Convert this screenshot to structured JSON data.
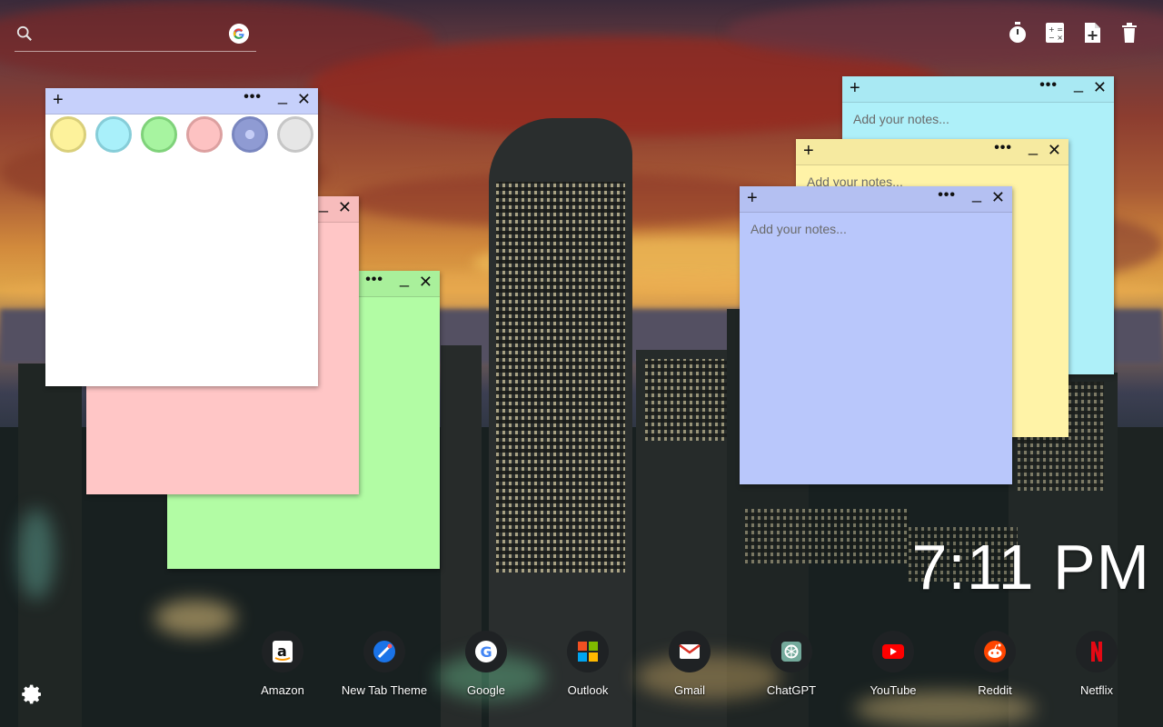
{
  "search": {
    "placeholder": ""
  },
  "top_icons": [
    "timer-icon",
    "calculator-icon",
    "add-note-icon",
    "trash-icon"
  ],
  "notes": [
    {
      "color": "#aef0f9",
      "bar_color": "#a9e9f3",
      "placeholder": "Add your notes..."
    },
    {
      "color": "#fff3a7",
      "bar_color": "#f6eaa0",
      "placeholder": "Add your notes..."
    },
    {
      "color": "#b9c7fb",
      "bar_color": "#b4c0f2",
      "placeholder": "Add your notes..."
    },
    {
      "color": "#ffc6c6",
      "bar_color": "#f7bcbc",
      "placeholder": ""
    },
    {
      "color": "#b2fca4",
      "bar_color": "#a9f09b",
      "placeholder": ""
    },
    {
      "color": "#ffffff",
      "bar_color": "#c6d0fb",
      "placeholder": ""
    }
  ],
  "note_controls": {
    "add": "+",
    "more": "•••",
    "minimize": "_",
    "close": "✕"
  },
  "color_swatches": [
    "#fdf29b",
    "#a9f0fa",
    "#a7f4a0",
    "#fdc2c2",
    "#8f9bd3",
    "#e6e6e6"
  ],
  "clock": {
    "time": "7:11 PM"
  },
  "dock": [
    {
      "label": "Amazon",
      "icon": "amazon-icon"
    },
    {
      "label": "New Tab Theme",
      "icon": "new-tab-theme-icon"
    },
    {
      "label": "Google",
      "icon": "google-icon"
    },
    {
      "label": "Outlook",
      "icon": "outlook-icon"
    },
    {
      "label": "Gmail",
      "icon": "gmail-icon"
    },
    {
      "label": "ChatGPT",
      "icon": "chatgpt-icon"
    },
    {
      "label": "YouTube",
      "icon": "youtube-icon"
    },
    {
      "label": "Reddit",
      "icon": "reddit-icon"
    },
    {
      "label": "Netflix",
      "icon": "netflix-icon"
    }
  ],
  "settings": {
    "icon": "gear-icon"
  }
}
